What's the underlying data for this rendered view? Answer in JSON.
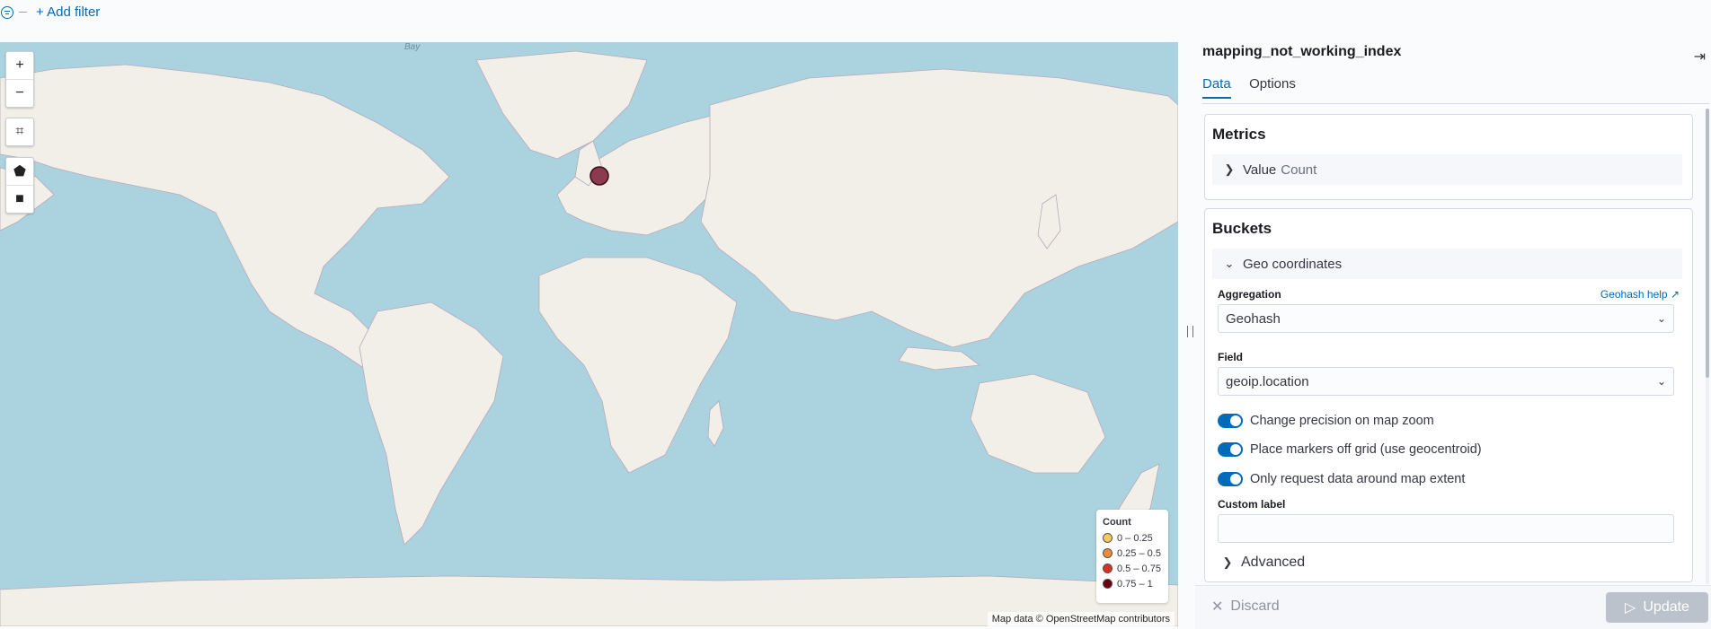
{
  "filter_bar": {
    "add_filter": "+ Add filter"
  },
  "map": {
    "controls": {
      "zoom_in": "+",
      "zoom_out": "−",
      "crop": "⌗",
      "polygon": "⬟",
      "rectangle": "■"
    },
    "labels": {
      "bay": "Bay"
    },
    "legend": {
      "title": "Count",
      "items": [
        {
          "label": "0 – 0.25",
          "color": "#f4c95d"
        },
        {
          "label": "0.25 – 0.5",
          "color": "#ee8a3a"
        },
        {
          "label": "0.5 – 0.75",
          "color": "#d93024"
        },
        {
          "label": "0.75 – 1",
          "color": "#67000d"
        }
      ]
    },
    "marker_color": "#8b3a4f",
    "attribution": "Map data © OpenStreetMap contributors"
  },
  "sidebar": {
    "title": "mapping_not_working_index",
    "tabs": [
      {
        "label": "Data",
        "active": true
      },
      {
        "label": "Options",
        "active": false
      }
    ],
    "metrics": {
      "title": "Metrics",
      "item_label": "Value",
      "item_value": "Count"
    },
    "buckets": {
      "title": "Buckets",
      "group_label": "Geo coordinates",
      "aggregation_label": "Aggregation",
      "aggregation_help": "Geohash help",
      "aggregation_value": "Geohash",
      "field_label": "Field",
      "field_value": "geoip.location",
      "switches": [
        {
          "label": "Change precision on map zoom",
          "on": true
        },
        {
          "label": "Place markers off grid (use geocentroid)",
          "on": true
        },
        {
          "label": "Only request data around map extent",
          "on": true
        }
      ],
      "custom_label": "Custom label",
      "custom_value": "",
      "advanced": "Advanced"
    },
    "footer": {
      "discard": "Discard",
      "update": "Update"
    },
    "accent_color": "#006bb8"
  }
}
